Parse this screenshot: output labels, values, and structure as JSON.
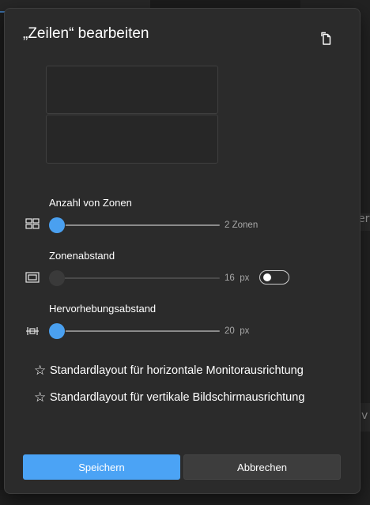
{
  "dialog": {
    "title": "„Zeilen“ bearbeiten",
    "copy_icon": "copy-icon"
  },
  "zones_preview": [
    {
      "label": ""
    },
    {
      "label": ""
    }
  ],
  "settings": {
    "zone_count": {
      "label": "Anzahl von Zonen",
      "value": 2,
      "value_text": "2",
      "unit": "Zonen",
      "fraction": 0.0,
      "icon": "grid-layout-icon"
    },
    "zone_spacing": {
      "label": "Zonenabstand",
      "value": 16,
      "value_text": "16",
      "unit": "px",
      "fraction": 0.0,
      "enabled": false,
      "icon": "spacing-frame-icon"
    },
    "highlight_distance": {
      "label": "Hervorhebungsabstand",
      "value": 20,
      "value_text": "20",
      "unit": "px",
      "fraction": 0.0,
      "icon": "highlight-distance-icon"
    }
  },
  "defaults": [
    {
      "icon": "star-icon",
      "label": "Standardlayout für horizontale Monitorausrichtung"
    },
    {
      "icon": "star-icon",
      "label": "Standardlayout für vertikale Bildschirmausrichtung"
    }
  ],
  "buttons": {
    "save": "Speichern",
    "cancel": "Abbrechen"
  },
  "background": {
    "fragment_1": "er",
    "fragment_2": "v"
  },
  "colors": {
    "accent": "#4ba3f5",
    "dialog_bg": "#2b2b2b"
  }
}
